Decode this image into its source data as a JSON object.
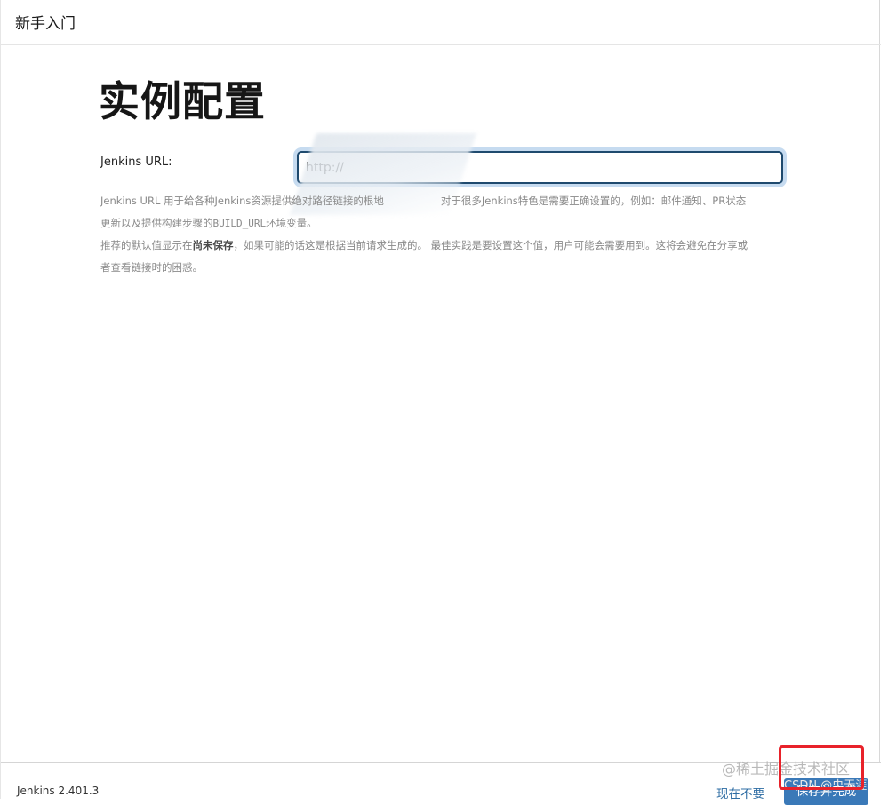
{
  "header": {
    "title": "新手入门"
  },
  "main": {
    "title": "实例配置",
    "url_label": "Jenkins URL:",
    "url_value": "http://",
    "help": {
      "p1_a": "Jenkins URL 用于给各种Jenkins资源提供绝对路径链接的根地",
      "p1_b": "对于很多Jenkins特色是需要正确设置的，例如：邮件通知、PR状态",
      "p1_c": "更新以及提供构建步骤的",
      "p1_var": "BUILD_URL",
      "p1_d": "环境变量。",
      "p2_a": "推荐的默认值显示在",
      "p2_bold": "尚未保存",
      "p2_b": "，如果可能的话这是根据当前请求生成的。 最佳实践是要设置这个值，用户可能会需要用到。这将会避免在分享或",
      "p2_c": "者查看链接时的困惑。"
    }
  },
  "footer": {
    "version": "Jenkins 2.401.3",
    "skip_label": "现在不要",
    "save_label": "保存并完成"
  },
  "watermark": {
    "site": "@稀土掘金技术社区",
    "csdn": "CSDN @虫无涯"
  },
  "colors": {
    "accent": "#3a79b8",
    "link": "#2e6da4",
    "highlight": "#e8222a"
  }
}
